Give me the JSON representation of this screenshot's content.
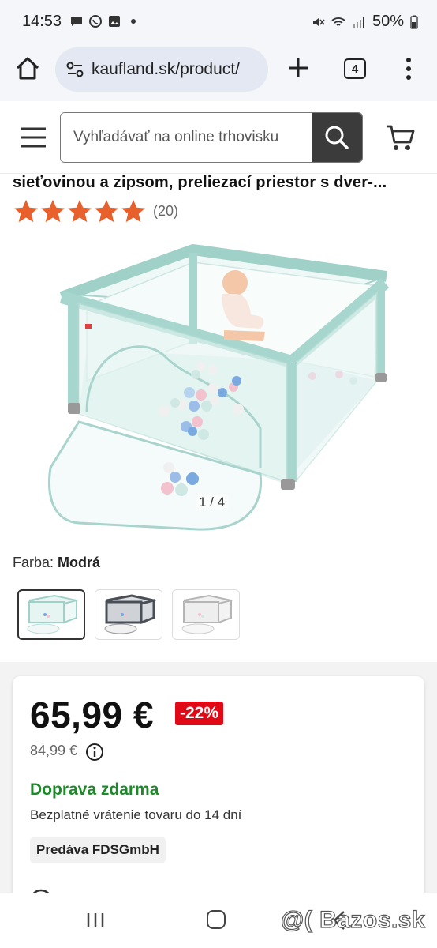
{
  "status_bar": {
    "time": "14:53",
    "battery": "50%"
  },
  "browser": {
    "url": "kaufland.sk/product/",
    "tab_count": "4"
  },
  "header": {
    "search_placeholder": "Vyhľadávať na online trhovisku"
  },
  "product": {
    "title_partial": "sieťovinou a zipsom, preliezací priestor s dver-...",
    "rating_stars": 5,
    "review_count": "(20)",
    "image_counter": "1 / 4",
    "color_label": "Farba:",
    "color_value": "Modrá",
    "color_options": [
      "mint",
      "dark-grey",
      "light-grey"
    ],
    "price": "65,99 €",
    "discount": "-22%",
    "old_price": "84,99 €",
    "shipping": "Doprava zdarma",
    "returns": "Bezplatné vrátenie tovaru do 14 dní",
    "seller": "Predáva FDSGmbH"
  },
  "watermark": "@( Bazos.sk",
  "colors": {
    "discount_red": "#e10915",
    "shipping_green": "#1d8a2a",
    "star_orange": "#e8612c"
  }
}
